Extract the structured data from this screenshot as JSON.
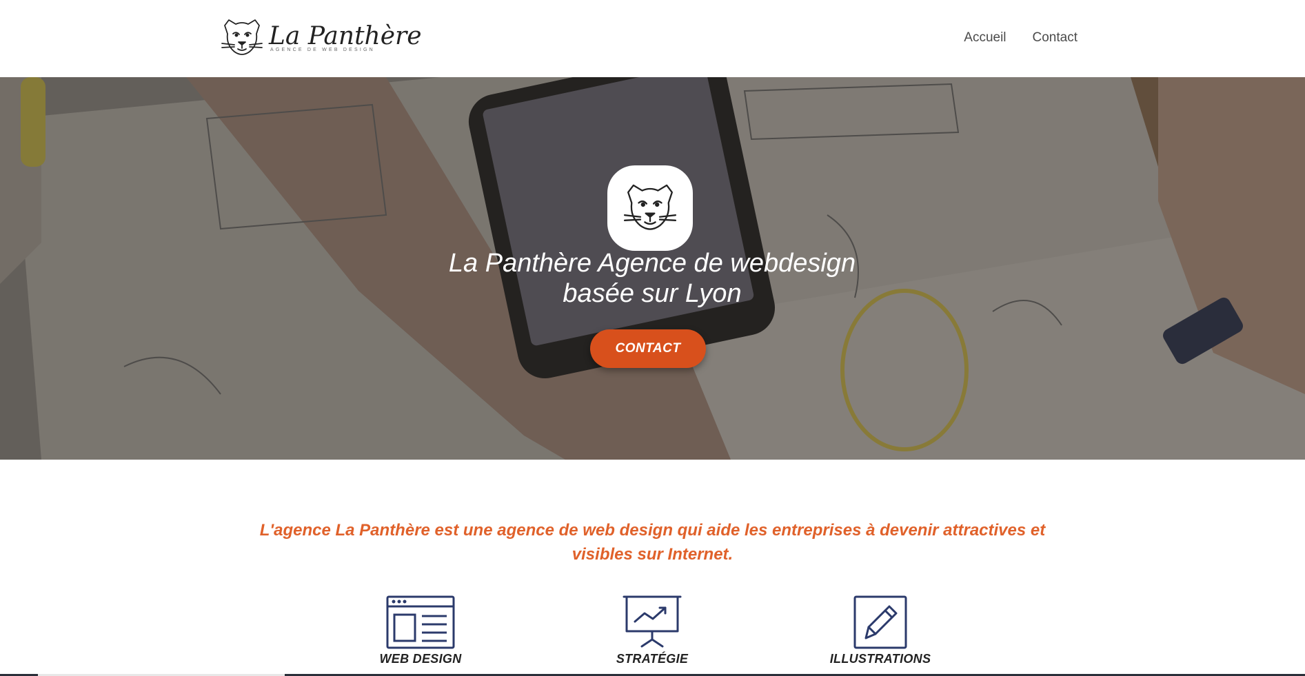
{
  "header": {
    "logo_title": "La Panthère",
    "logo_subtitle": "AGENCE DE WEB DESIGN",
    "nav": [
      {
        "label": "Accueil"
      },
      {
        "label": "Contact"
      }
    ]
  },
  "hero": {
    "title_line1": "La Panthère Agence de webdesign",
    "title_line2": "basée sur Lyon",
    "cta_label": "CONTACT",
    "cta_color": "#d8501c"
  },
  "intro": {
    "text": "L'agence La Panthère est une agence de web design qui aide les entreprises à devenir attractives et visibles sur Internet.",
    "color": "#e0612a"
  },
  "services": [
    {
      "label": "WEB DESIGN",
      "icon": "browser-layout-icon"
    },
    {
      "label": "STRATÉGIE",
      "icon": "presentation-chart-icon"
    },
    {
      "label": "ILLUSTRATIONS",
      "icon": "pencil-icon"
    }
  ],
  "colors": {
    "icon_stroke": "#2b3a6b",
    "accent": "#d8501c"
  }
}
